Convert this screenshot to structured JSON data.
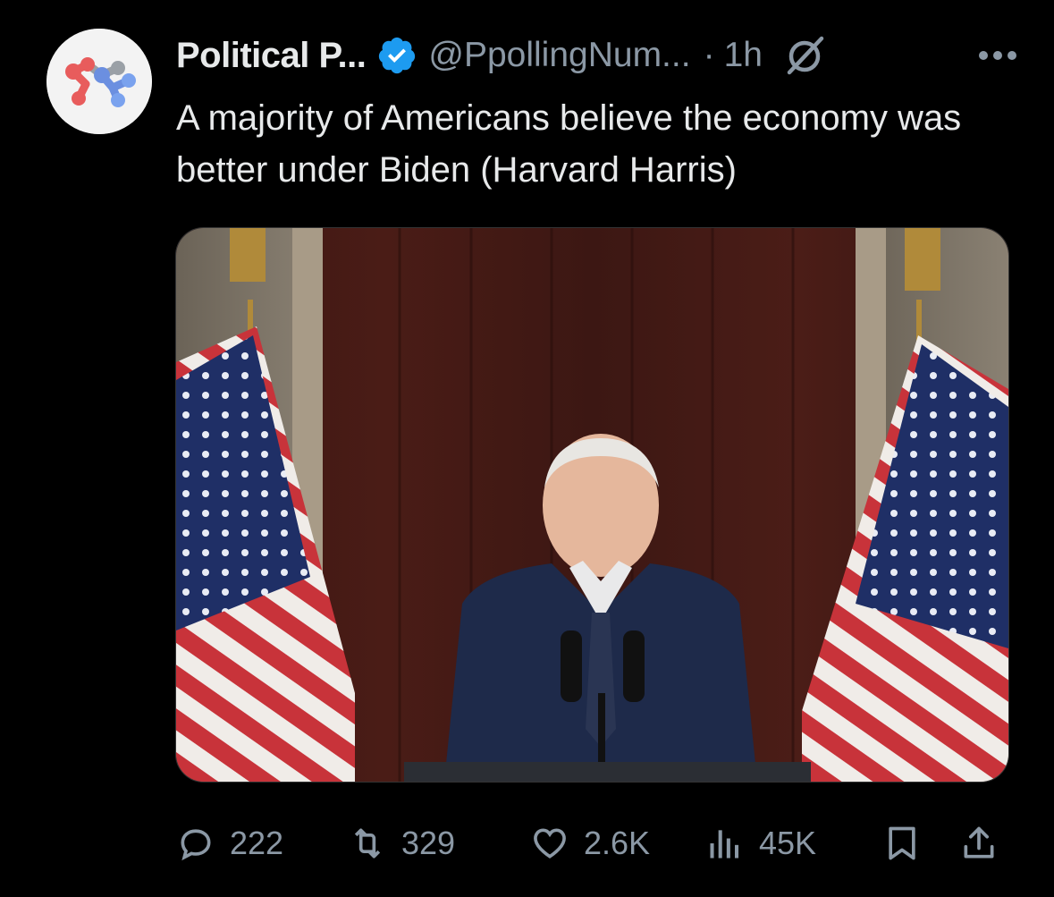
{
  "tweet": {
    "display_name": "Political P...",
    "handle": "@PpollingNum...",
    "separator": "·",
    "time": "1h",
    "text": "A majority of Americans believe the economy was better under Biden (Harvard Harris)",
    "verified": true,
    "icons": [
      "avatar-logo",
      "verified-badge-icon",
      "grok-icon",
      "more-icon"
    ]
  },
  "media": {
    "description_icon": "photo"
  },
  "actions": {
    "replies": "222",
    "retweets": "329",
    "likes": "2.6K",
    "views": "45K",
    "icons": [
      "reply-icon",
      "retweet-icon",
      "like-icon",
      "views-icon",
      "bookmark-icon",
      "share-icon"
    ]
  },
  "colors": {
    "background": "#000000",
    "text": "#e7e9ea",
    "secondary": "#8b98a5",
    "verified": "#1d9bf0"
  }
}
